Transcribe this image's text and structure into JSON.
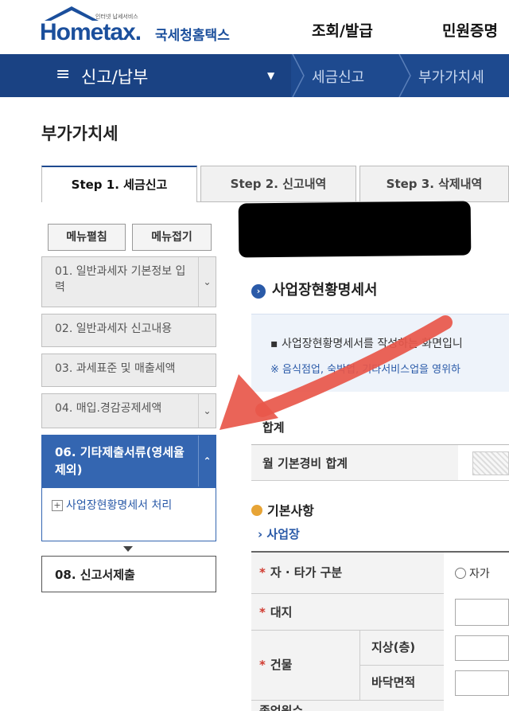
{
  "header": {
    "logo_text": "Hometax.",
    "logo_small": "인터넷 납세서비스",
    "logo_sub": "국세청홈택스",
    "menu": [
      "조회/발급",
      "민원증명"
    ]
  },
  "nav": {
    "title": "신고/납부",
    "crumbs": [
      "세금신고",
      "부가가치세"
    ]
  },
  "page": {
    "title": "부가가치세"
  },
  "tabs": [
    {
      "label": "Step 1. 세금신고"
    },
    {
      "label": "Step 2. 신고내역"
    },
    {
      "label": "Step 3. 삭제내역"
    }
  ],
  "sidebar": {
    "expand_label": "메뉴펼침",
    "collapse_label": "메뉴접기",
    "items": [
      {
        "label": "01. 일반과세자 기본정보 입력"
      },
      {
        "label": "02. 일반과세자 신고내용"
      },
      {
        "label": "03. 과세표준 및 매출세액"
      },
      {
        "label": "04. 매입.경감공제세액"
      },
      {
        "label": "06. 기타제출서류(영세율제외)"
      }
    ],
    "submenu_label": "사업장현황명세서 처리",
    "final_label": "08. 신고서제출"
  },
  "main": {
    "section_title": "사업장현황명세서",
    "info_line1": "사업장현황명세서를 작성하는 화면입니",
    "info_line2": "※ 음식점업, 숙박업, 기타서비스업을 영위하",
    "sum_title": "합계",
    "sum_row_label": "월 기본경비 합계",
    "basic_title": "기본사항",
    "sub_title": "› 사업장",
    "rows": {
      "ownership": "자 · 타가 구분",
      "ownership_option": "자가",
      "land": "대지",
      "building": "건물",
      "above_floors": "지상(층)",
      "floor_area": "바닥면적",
      "cut_label": "종업원수"
    }
  }
}
